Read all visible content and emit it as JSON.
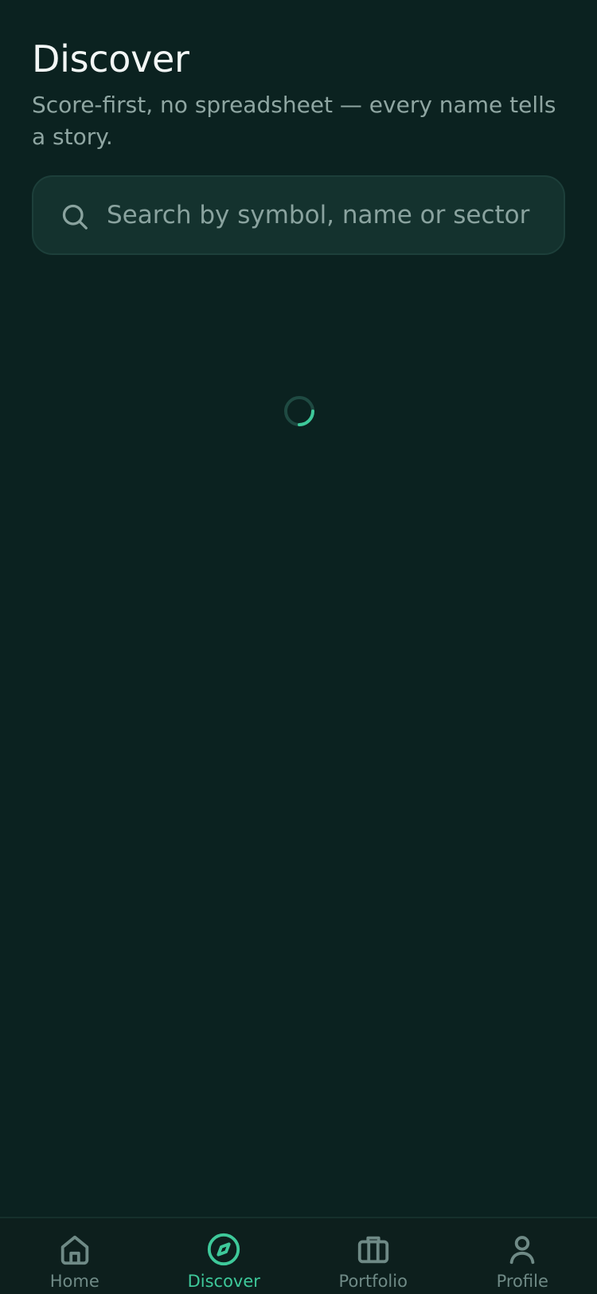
{
  "header": {
    "title": "Discover",
    "subtitle": "Score-first, no spreadsheet — every name tells a story."
  },
  "search": {
    "placeholder": "Search by symbol, name or sector",
    "value": "",
    "icon": "search-icon"
  },
  "loading": {
    "state": "loading",
    "icon": "spinner-icon"
  },
  "tabbar": {
    "active": "Discover",
    "accent_color": "#3ec99a",
    "inactive_color": "#6f8a86",
    "items": [
      {
        "label": "Home",
        "icon": "home-icon"
      },
      {
        "label": "Discover",
        "icon": "compass-icon"
      },
      {
        "label": "Portfolio",
        "icon": "briefcase-icon"
      },
      {
        "label": "Profile",
        "icon": "user-icon"
      }
    ]
  }
}
